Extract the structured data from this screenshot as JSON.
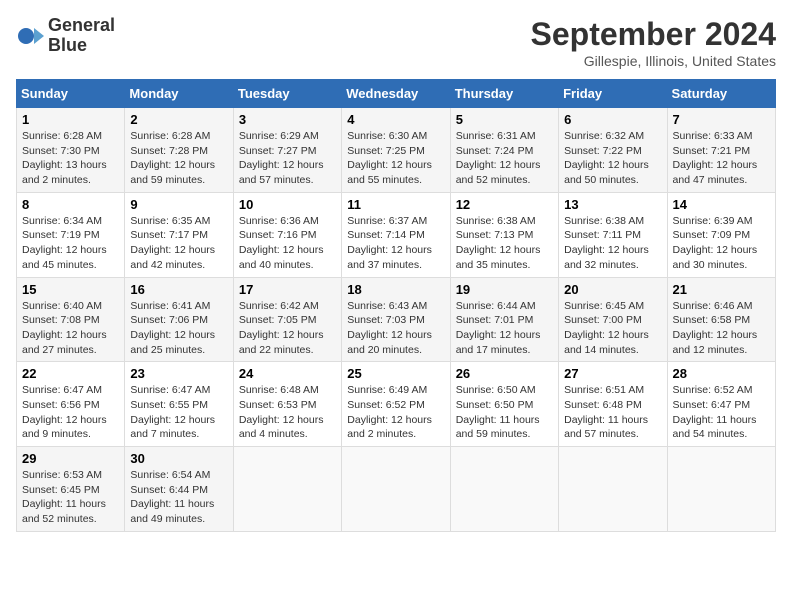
{
  "header": {
    "logo_line1": "General",
    "logo_line2": "Blue",
    "month": "September 2024",
    "location": "Gillespie, Illinois, United States"
  },
  "days_of_week": [
    "Sunday",
    "Monday",
    "Tuesday",
    "Wednesday",
    "Thursday",
    "Friday",
    "Saturday"
  ],
  "weeks": [
    [
      {
        "day": "1",
        "info": "Sunrise: 6:28 AM\nSunset: 7:30 PM\nDaylight: 13 hours\nand 2 minutes."
      },
      {
        "day": "2",
        "info": "Sunrise: 6:28 AM\nSunset: 7:28 PM\nDaylight: 12 hours\nand 59 minutes."
      },
      {
        "day": "3",
        "info": "Sunrise: 6:29 AM\nSunset: 7:27 PM\nDaylight: 12 hours\nand 57 minutes."
      },
      {
        "day": "4",
        "info": "Sunrise: 6:30 AM\nSunset: 7:25 PM\nDaylight: 12 hours\nand 55 minutes."
      },
      {
        "day": "5",
        "info": "Sunrise: 6:31 AM\nSunset: 7:24 PM\nDaylight: 12 hours\nand 52 minutes."
      },
      {
        "day": "6",
        "info": "Sunrise: 6:32 AM\nSunset: 7:22 PM\nDaylight: 12 hours\nand 50 minutes."
      },
      {
        "day": "7",
        "info": "Sunrise: 6:33 AM\nSunset: 7:21 PM\nDaylight: 12 hours\nand 47 minutes."
      }
    ],
    [
      {
        "day": "8",
        "info": "Sunrise: 6:34 AM\nSunset: 7:19 PM\nDaylight: 12 hours\nand 45 minutes."
      },
      {
        "day": "9",
        "info": "Sunrise: 6:35 AM\nSunset: 7:17 PM\nDaylight: 12 hours\nand 42 minutes."
      },
      {
        "day": "10",
        "info": "Sunrise: 6:36 AM\nSunset: 7:16 PM\nDaylight: 12 hours\nand 40 minutes."
      },
      {
        "day": "11",
        "info": "Sunrise: 6:37 AM\nSunset: 7:14 PM\nDaylight: 12 hours\nand 37 minutes."
      },
      {
        "day": "12",
        "info": "Sunrise: 6:38 AM\nSunset: 7:13 PM\nDaylight: 12 hours\nand 35 minutes."
      },
      {
        "day": "13",
        "info": "Sunrise: 6:38 AM\nSunset: 7:11 PM\nDaylight: 12 hours\nand 32 minutes."
      },
      {
        "day": "14",
        "info": "Sunrise: 6:39 AM\nSunset: 7:09 PM\nDaylight: 12 hours\nand 30 minutes."
      }
    ],
    [
      {
        "day": "15",
        "info": "Sunrise: 6:40 AM\nSunset: 7:08 PM\nDaylight: 12 hours\nand 27 minutes."
      },
      {
        "day": "16",
        "info": "Sunrise: 6:41 AM\nSunset: 7:06 PM\nDaylight: 12 hours\nand 25 minutes."
      },
      {
        "day": "17",
        "info": "Sunrise: 6:42 AM\nSunset: 7:05 PM\nDaylight: 12 hours\nand 22 minutes."
      },
      {
        "day": "18",
        "info": "Sunrise: 6:43 AM\nSunset: 7:03 PM\nDaylight: 12 hours\nand 20 minutes."
      },
      {
        "day": "19",
        "info": "Sunrise: 6:44 AM\nSunset: 7:01 PM\nDaylight: 12 hours\nand 17 minutes."
      },
      {
        "day": "20",
        "info": "Sunrise: 6:45 AM\nSunset: 7:00 PM\nDaylight: 12 hours\nand 14 minutes."
      },
      {
        "day": "21",
        "info": "Sunrise: 6:46 AM\nSunset: 6:58 PM\nDaylight: 12 hours\nand 12 minutes."
      }
    ],
    [
      {
        "day": "22",
        "info": "Sunrise: 6:47 AM\nSunset: 6:56 PM\nDaylight: 12 hours\nand 9 minutes."
      },
      {
        "day": "23",
        "info": "Sunrise: 6:47 AM\nSunset: 6:55 PM\nDaylight: 12 hours\nand 7 minutes."
      },
      {
        "day": "24",
        "info": "Sunrise: 6:48 AM\nSunset: 6:53 PM\nDaylight: 12 hours\nand 4 minutes."
      },
      {
        "day": "25",
        "info": "Sunrise: 6:49 AM\nSunset: 6:52 PM\nDaylight: 12 hours\nand 2 minutes."
      },
      {
        "day": "26",
        "info": "Sunrise: 6:50 AM\nSunset: 6:50 PM\nDaylight: 11 hours\nand 59 minutes."
      },
      {
        "day": "27",
        "info": "Sunrise: 6:51 AM\nSunset: 6:48 PM\nDaylight: 11 hours\nand 57 minutes."
      },
      {
        "day": "28",
        "info": "Sunrise: 6:52 AM\nSunset: 6:47 PM\nDaylight: 11 hours\nand 54 minutes."
      }
    ],
    [
      {
        "day": "29",
        "info": "Sunrise: 6:53 AM\nSunset: 6:45 PM\nDaylight: 11 hours\nand 52 minutes."
      },
      {
        "day": "30",
        "info": "Sunrise: 6:54 AM\nSunset: 6:44 PM\nDaylight: 11 hours\nand 49 minutes."
      },
      {
        "day": "",
        "info": ""
      },
      {
        "day": "",
        "info": ""
      },
      {
        "day": "",
        "info": ""
      },
      {
        "day": "",
        "info": ""
      },
      {
        "day": "",
        "info": ""
      }
    ]
  ]
}
